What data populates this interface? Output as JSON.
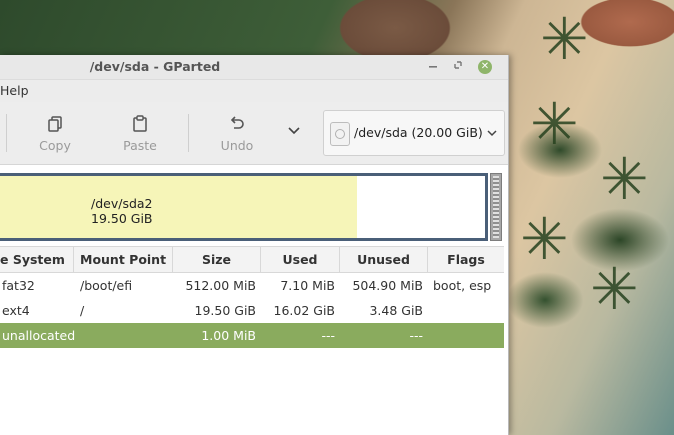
{
  "window": {
    "title": "/dev/sda - GParted",
    "controls": [
      "minimize",
      "maximize",
      "close"
    ]
  },
  "menu": {
    "items": [
      "Help"
    ]
  },
  "toolbar": {
    "buttons": [
      {
        "label": "Copy",
        "icon": "copy-icon",
        "enabled": false
      },
      {
        "label": "Paste",
        "icon": "paste-icon",
        "enabled": false
      },
      {
        "label": "Undo",
        "icon": "undo-icon",
        "enabled": false
      }
    ],
    "more_icon": "chevron-down-icon",
    "device_selector": {
      "label": "/dev/sda  (20.00 GiB)",
      "icon": "disk-icon"
    }
  },
  "partition_map": {
    "selected_partition_name": "/dev/sda2",
    "selected_partition_size": "19.50 GiB"
  },
  "table": {
    "columns": [
      "e System",
      "Mount Point",
      "Size",
      "Used",
      "Unused",
      "Flags"
    ],
    "rows": [
      {
        "filesystem": "fat32",
        "mount": "/boot/efi",
        "size": "512.00 MiB",
        "used": "7.10 MiB",
        "unused": "504.90 MiB",
        "flags": "boot, esp",
        "selected": false
      },
      {
        "filesystem": "ext4",
        "mount": "/",
        "size": "19.50 GiB",
        "used": "16.02 GiB",
        "unused": "3.48 GiB",
        "flags": "",
        "selected": false
      },
      {
        "filesystem": "unallocated",
        "mount": "",
        "size": "1.00 MiB",
        "used": "---",
        "unused": "---",
        "flags": "",
        "selected": true
      }
    ]
  },
  "colors": {
    "selection": "#8aab5e",
    "partition_used": "#f6f5b8",
    "partition_frame": "#4a5f78"
  }
}
